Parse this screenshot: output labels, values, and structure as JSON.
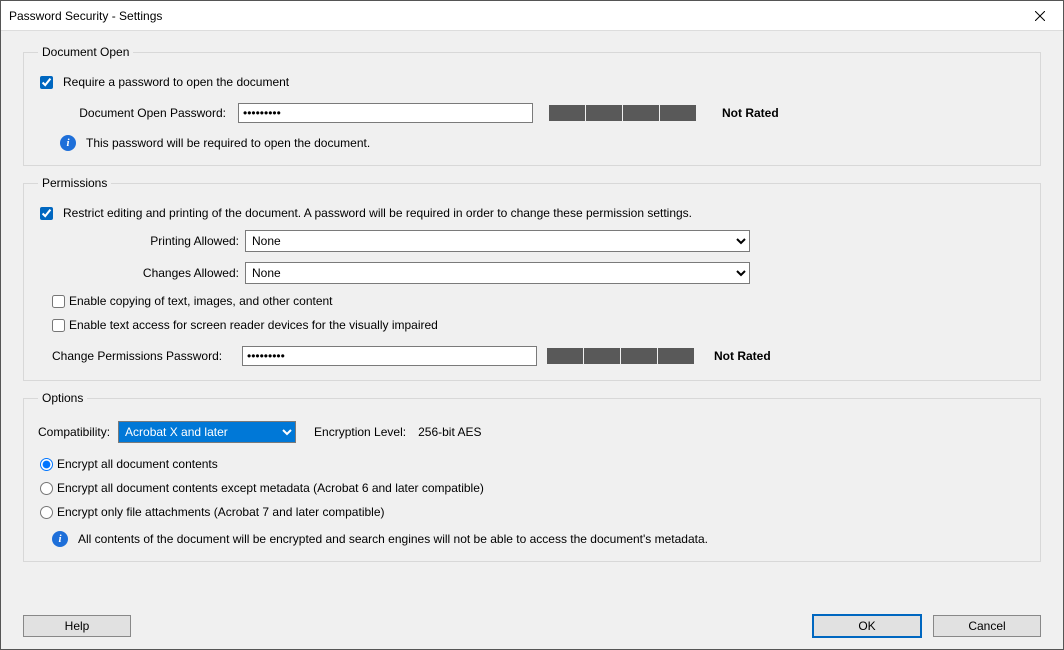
{
  "titlebar": {
    "title": "Password Security - Settings"
  },
  "documentOpen": {
    "legend": "Document Open",
    "requireCheckbox": "Require a password to open the document",
    "passwordLabel": "Document Open Password:",
    "passwordValue": "*********",
    "strengthLabel": "Not Rated",
    "infoText": "This password will be required to open the document."
  },
  "permissions": {
    "legend": "Permissions",
    "restrictCheckbox": "Restrict editing and printing of the document. A password will be required in order to change these permission settings.",
    "printingLabel": "Printing Allowed:",
    "printingValue": "None",
    "changesLabel": "Changes Allowed:",
    "changesValue": "None",
    "enableCopy": "Enable copying of text, images, and other content",
    "enableScreenReader": "Enable text access for screen reader devices for the visually impaired",
    "changePwLabel": "Change Permissions Password:",
    "changePwValue": "*********",
    "strengthLabel": "Not Rated"
  },
  "options": {
    "legend": "Options",
    "compatLabel": "Compatibility:",
    "compatValue": "Acrobat X and later",
    "encryptionLevelLabel": "Encryption  Level:",
    "encryptionLevelValue": "256-bit AES",
    "radioAll": "Encrypt all document contents",
    "radioExceptMeta": "Encrypt all document contents except metadata (Acrobat 6 and later compatible)",
    "radioAttachments": "Encrypt only file attachments (Acrobat 7 and later compatible)",
    "infoText": "All contents of the document will be encrypted and search engines will not be able to access the document's metadata."
  },
  "buttons": {
    "help": "Help",
    "ok": "OK",
    "cancel": "Cancel"
  }
}
